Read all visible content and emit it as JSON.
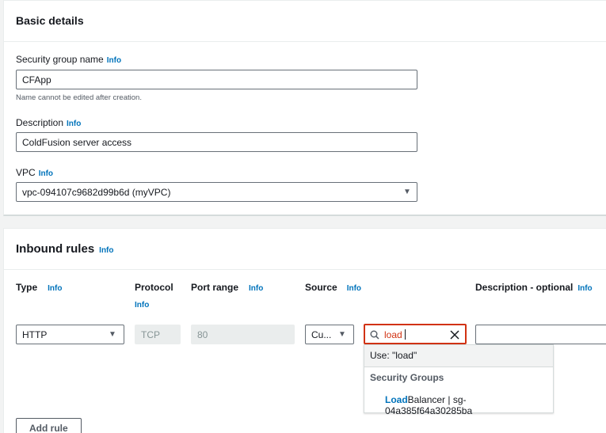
{
  "basic": {
    "title": "Basic details",
    "sg_name_label": "Security group name",
    "info": "Info",
    "sg_name_value": "CFApp",
    "sg_name_hint": "Name cannot be edited after creation.",
    "description_label": "Description",
    "description_value": "ColdFusion server access",
    "vpc_label": "VPC",
    "vpc_value": "vpc-094107c9682d99b6d (myVPC)"
  },
  "inbound": {
    "title": "Inbound rules",
    "info": "Info",
    "columns": {
      "type": "Type",
      "protocol": "Protocol",
      "port_range": "Port range",
      "source": "Source",
      "description": "Description - optional"
    },
    "rule": {
      "type": "HTTP",
      "protocol": "TCP",
      "port": "80",
      "source_type": "Cu...",
      "search_value": "load",
      "description": ""
    },
    "dropdown": {
      "use_option": "Use: \"load\"",
      "group_header": "Security Groups",
      "option_match": "Load",
      "option_rest": "Balancer | sg-04a385f64a30285ba"
    },
    "add_rule": "Add rule"
  },
  "colors": {
    "link": "#0073bb",
    "error": "#d13212",
    "text": "#16191f"
  }
}
